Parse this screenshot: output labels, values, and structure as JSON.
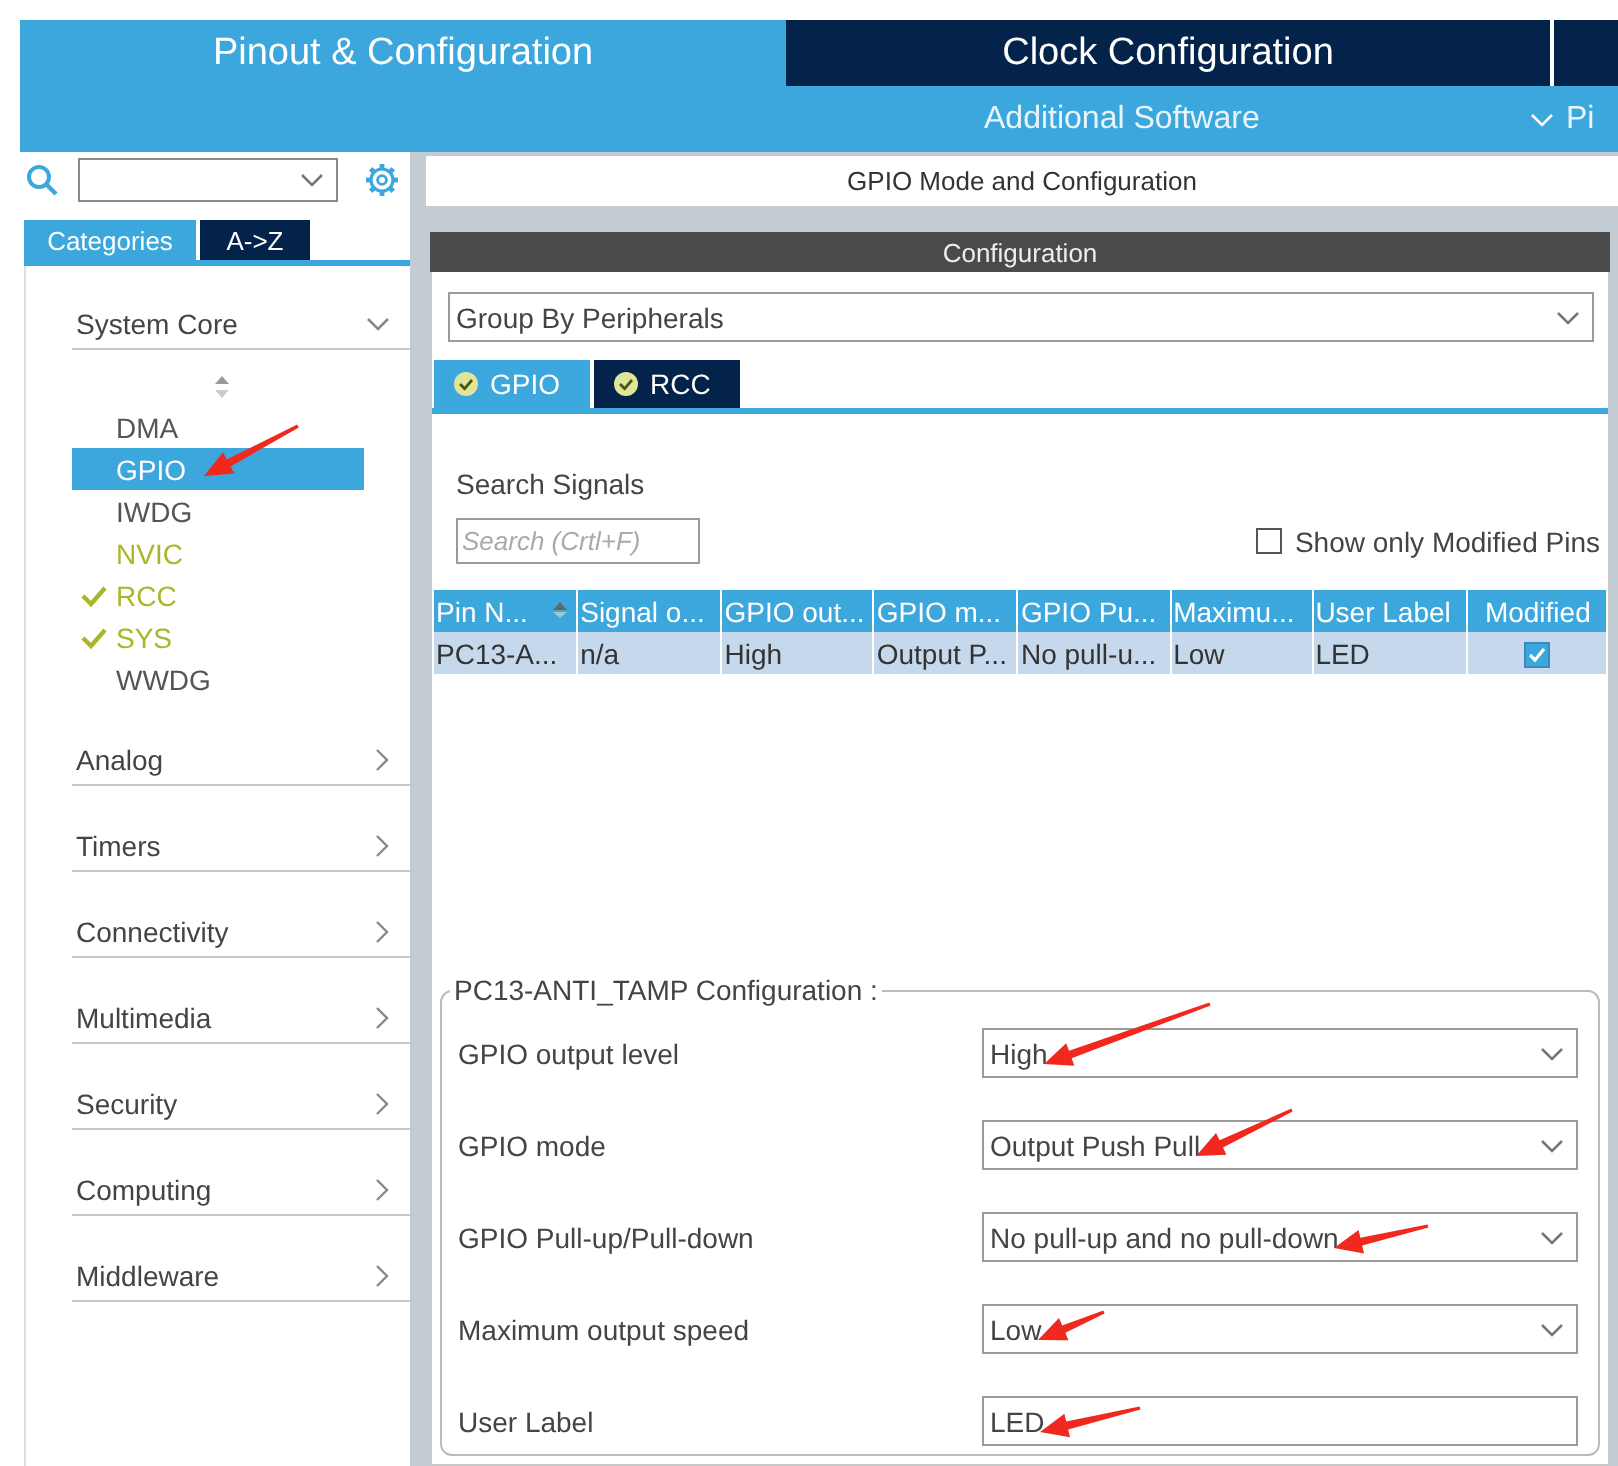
{
  "header": {
    "tabs": [
      {
        "label": "Pinout & Configuration",
        "selected": true
      },
      {
        "label": "Clock Configuration",
        "selected": false
      }
    ],
    "subtabs": [
      {
        "label": "Additional Software",
        "expandable": false
      },
      {
        "label": "Pi",
        "expandable": true
      }
    ]
  },
  "sidebar": {
    "view_tabs": [
      {
        "label": "Categories",
        "selected": true
      },
      {
        "label": "A->Z",
        "selected": false
      }
    ],
    "categories": [
      {
        "label": "System Core",
        "expanded": true,
        "items": [
          {
            "label": "DMA",
            "selected": false,
            "enabled": false,
            "checked": false,
            "pointed": false
          },
          {
            "label": "GPIO",
            "selected": true,
            "enabled": false,
            "checked": false,
            "pointed": true
          },
          {
            "label": "IWDG",
            "selected": false,
            "enabled": false,
            "checked": false,
            "pointed": false
          },
          {
            "label": "NVIC",
            "selected": false,
            "enabled": true,
            "checked": false,
            "pointed": false
          },
          {
            "label": "RCC",
            "selected": false,
            "enabled": true,
            "checked": true,
            "pointed": false
          },
          {
            "label": "SYS",
            "selected": false,
            "enabled": true,
            "checked": true,
            "pointed": false
          },
          {
            "label": "WWDG",
            "selected": false,
            "enabled": false,
            "checked": false,
            "pointed": false
          }
        ]
      },
      {
        "label": "Analog",
        "expanded": false
      },
      {
        "label": "Timers",
        "expanded": false
      },
      {
        "label": "Connectivity",
        "expanded": false
      },
      {
        "label": "Multimedia",
        "expanded": false
      },
      {
        "label": "Security",
        "expanded": false
      },
      {
        "label": "Computing",
        "expanded": false
      },
      {
        "label": "Middleware",
        "expanded": false
      }
    ]
  },
  "main": {
    "title": "GPIO Mode and Configuration",
    "section": "Configuration",
    "group_by": "Group By Peripherals",
    "tabs": [
      {
        "label": "GPIO",
        "selected": true
      },
      {
        "label": "RCC",
        "selected": false
      }
    ],
    "search_label": "Search Signals",
    "search": {
      "placeholder": "Search (Crtl+F)"
    },
    "show_modified": {
      "label": "Show only Modified Pins",
      "checked": false
    },
    "table": {
      "columns": [
        {
          "label": "Pin N...",
          "sorted": true
        },
        {
          "label": "Signal o...",
          "sorted": false
        },
        {
          "label": "GPIO out...",
          "sorted": false
        },
        {
          "label": "GPIO m...",
          "sorted": false
        },
        {
          "label": "GPIO Pu...",
          "sorted": false
        },
        {
          "label": "Maximu...",
          "sorted": false
        },
        {
          "label": "User Label",
          "sorted": false
        },
        {
          "label": "Modified",
          "sorted": false
        }
      ],
      "rows": [
        {
          "cells": [
            "PC13-A...",
            "n/a",
            "High",
            "Output P...",
            "No pull-u...",
            "Low",
            "LED"
          ],
          "modified": true,
          "selected": true
        }
      ]
    },
    "pin_config": {
      "title": "PC13-ANTI_TAMP Configuration :",
      "fields": [
        {
          "label": "GPIO output level",
          "value": "High",
          "kind": "select",
          "pointed": true
        },
        {
          "label": "GPIO mode",
          "value": "Output Push Pull",
          "kind": "select",
          "pointed": true
        },
        {
          "label": "GPIO Pull-up/Pull-down",
          "value": "No pull-up and no pull-down",
          "kind": "select",
          "pointed": true
        },
        {
          "label": "Maximum output speed",
          "value": "Low",
          "kind": "select",
          "pointed": true
        },
        {
          "label": "User Label",
          "value": "LED",
          "kind": "text",
          "pointed": true
        }
      ]
    }
  }
}
